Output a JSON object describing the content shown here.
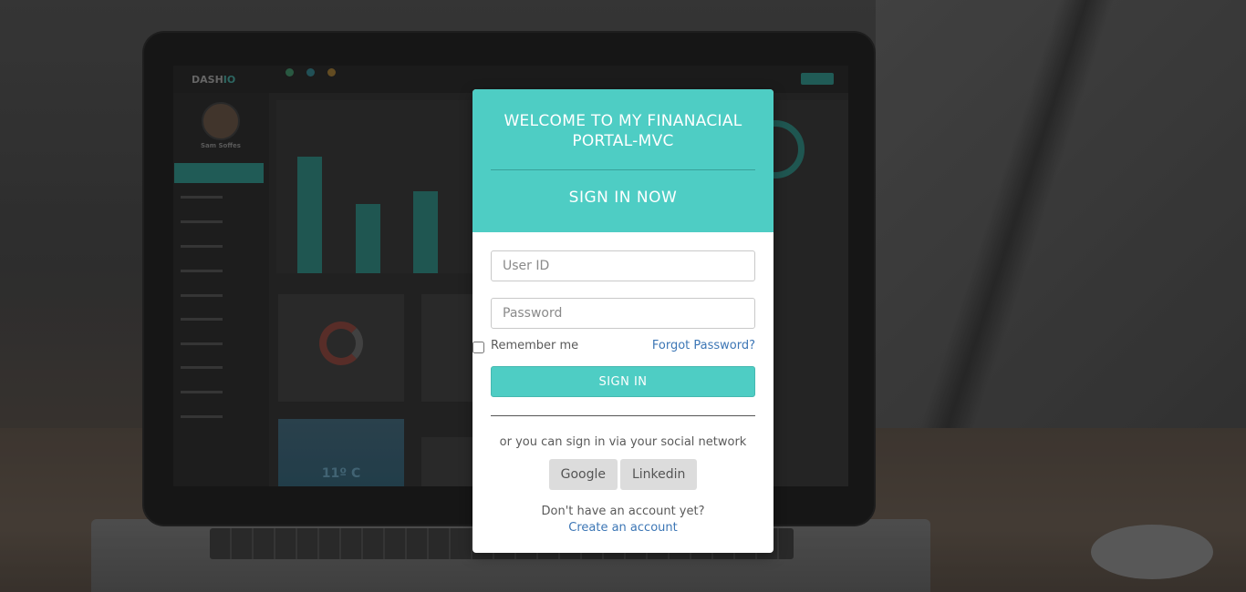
{
  "background": {
    "brand_prefix": "DASH",
    "brand_suffix": "IO",
    "user_name": "Sam Soffes",
    "weather_temp": "11º C"
  },
  "login": {
    "welcome_title": "WELCOME TO MY FINANACIAL PORTAL-MVC",
    "signin_heading": "SIGN IN NOW",
    "user_id_placeholder": "User ID",
    "password_placeholder": "Password",
    "remember_label": "Remember me",
    "remember_checked": false,
    "forgot_label": "Forgot Password?",
    "signin_button": "SIGN IN",
    "social_text": "or you can sign in via your social network",
    "social_buttons": [
      "Google",
      "Linkedin"
    ],
    "register_question": "Don't have an account yet?",
    "register_link": "Create an account"
  },
  "colors": {
    "accent": "#4ecdc4",
    "link": "#3c76b5"
  }
}
